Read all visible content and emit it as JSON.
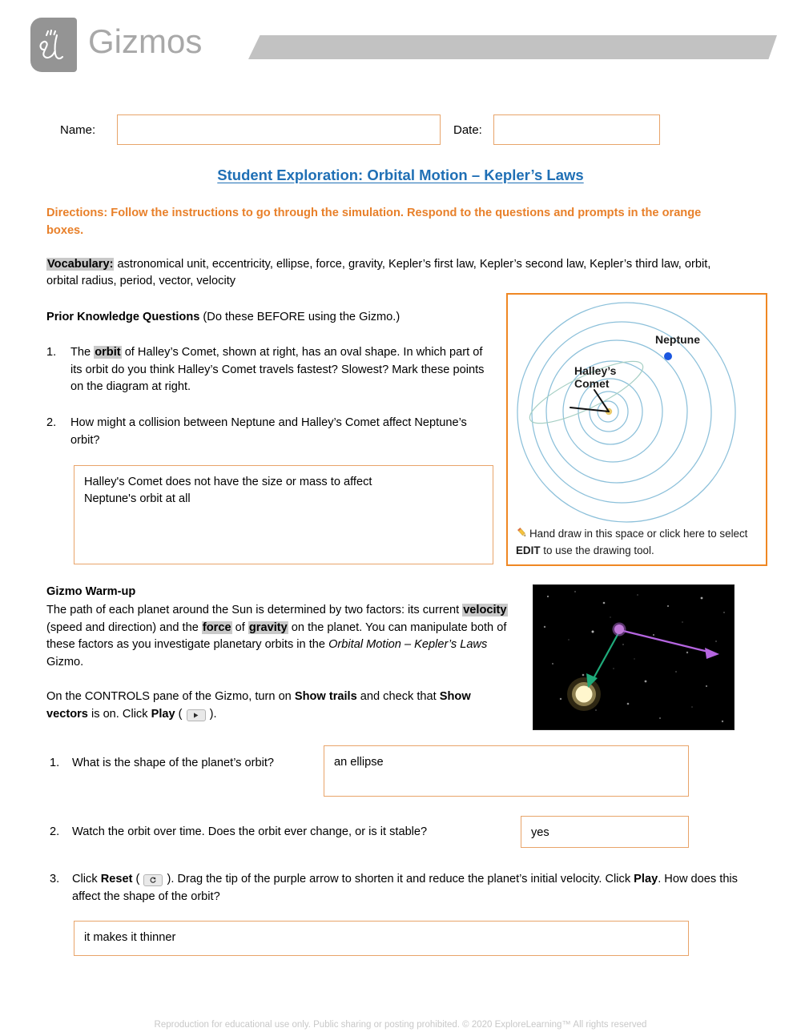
{
  "header": {
    "logo_word": "Gizmos",
    "logo_mark": "el-monogram-logo"
  },
  "meta_fields": {
    "name_label": "Name:",
    "name_value": "",
    "date_label": "Date:",
    "date_value": ""
  },
  "title": "Student Exploration: Orbital Motion – Kepler’s Laws",
  "directions": "Directions: Follow the instructions to go through the simulation. Respond to the questions and prompts in the orange boxes.",
  "vocabulary": {
    "label": "Vocabulary:",
    "terms": " astronomical unit, eccentricity, ellipse, force, gravity, Kepler’s first law, Kepler’s second law, Kepler’s third law, orbit, orbital radius, period, vector, velocity"
  },
  "prior_knowledge": {
    "heading_bold": "Prior Knowledge Questions",
    "heading_rest": " (Do these BEFORE using the Gizmo.)",
    "q1": {
      "number": "1.",
      "part_a": "The ",
      "highlight": "orbit",
      "part_b": " of Halley’s Comet, shown at right, has an oval shape. In which part of its orbit do you think Halley’s Comet travels fastest? Slowest? Mark these points on the diagram at right."
    },
    "q2": {
      "number": "2.",
      "text": "How might a collision between Neptune and Halley’s Comet affect Neptune’s orbit?",
      "answer": "Halley's Comet does not have the size or mass to affect\nNeptune's orbit at all"
    }
  },
  "orbit_diagram": {
    "label_neptune": "Neptune",
    "label_comet_line1": "Halley’s",
    "label_comet_line2": "Comet",
    "caption_part_a": "Hand draw in this space or click here to select ",
    "caption_bold": "EDIT",
    "caption_part_b": " to use the drawing tool.",
    "pencil_icon": "pencil-icon",
    "orbit_color": "#7fb8d4",
    "neptune_color": "#1a56e0",
    "sun_color": "#e8c86a",
    "border_color": "#ef8723"
  },
  "warm_up": {
    "heading": "Gizmo Warm-up",
    "p1_a": "The path of each planet around the Sun is determined by two factors: its current ",
    "p1_hl1": "velocity",
    "p1_b": " (speed and direction) and the ",
    "p1_hl2": "force",
    "p1_c": " of ",
    "p1_hl3": "gravity",
    "p1_d": " on the planet. You can manipulate both of these factors as you investigate planetary orbits in the ",
    "p1_italic": "Orbital Motion – Kepler’s Laws",
    "p1_e": " Gizmo.",
    "p2_a": "On the CONTROLS pane of the Gizmo, turn on ",
    "p2_b1": "Show trails",
    "p2_b": " and check that ",
    "p2_b2": "Show vectors",
    "p2_c": " is on. Click ",
    "p2_b3": "Play",
    "p2_d": " ( ",
    "p2_e": " )."
  },
  "space_image": {
    "alt": "planet-orbit-simulation-screenshot",
    "sun_color": "#fff3c0",
    "planet_color": "#c07ad8",
    "velocity_vector_color": "#b565e0",
    "gravity_vector_color": "#1faa7a"
  },
  "warm_up_questions": [
    {
      "number": "1.",
      "text": "What is the shape of the planet’s orbit?",
      "answer": "an ellipse"
    },
    {
      "number": "2.",
      "text": "Watch the orbit over time. Does the orbit ever change, or is it stable?",
      "answer": "yes"
    },
    {
      "number": "3.",
      "text_a": "Click ",
      "text_bold1": "Reset",
      "text_b": " ( ",
      "text_c": " ). Drag the tip of the purple arrow to shorten it and reduce the planet’s initial velocity. Click ",
      "text_bold2": "Play",
      "text_d": ". How does this affect the shape of the orbit?",
      "answer": "it makes it thinner"
    }
  ],
  "icons": {
    "play": "play-icon",
    "reset": "reset-icon"
  },
  "footer": "Reproduction for educational use only. Public sharing or posting prohibited. © 2020 ExploreLearning™ All rights reserved",
  "colors": {
    "accent_orange": "#e8802a",
    "box_orange": "#e8a46a",
    "panel_orange": "#ef8723",
    "title_blue": "#1f6fb5",
    "highlight_gray": "#c9c9c9",
    "logo_gray": "#949494",
    "banner_gray": "#c2c2c2"
  }
}
